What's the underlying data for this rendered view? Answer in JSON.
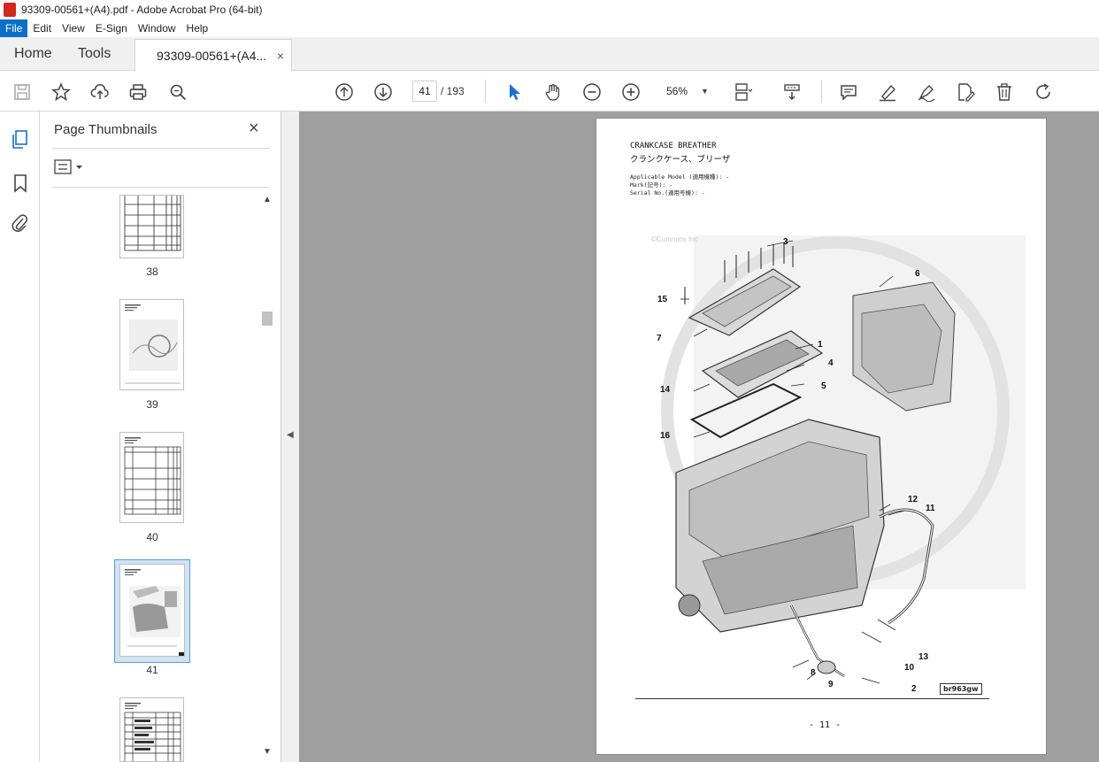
{
  "window": {
    "title": "93309-00561+(A4).pdf - Adobe Acrobat Pro (64-bit)"
  },
  "menu": [
    "File",
    "Edit",
    "View",
    "E-Sign",
    "Window",
    "Help"
  ],
  "tabs": {
    "home": "Home",
    "tools": "Tools",
    "document": "93309-00561+(A4...",
    "close": "×"
  },
  "toolbar": {
    "page_current": "41",
    "page_total": "/ 193",
    "zoom": "56%"
  },
  "thumbnails": {
    "title": "Page Thumbnails",
    "close": "×",
    "pages": [
      "38",
      "39",
      "40",
      "41",
      ""
    ]
  },
  "document": {
    "heading": "CRANKCASE BREATHER",
    "heading_jp": "クランクケース、ブリーザ",
    "applicable_model": "Applicable Model (適用機種): -",
    "mark": "Mark(記号): -",
    "serial": "Serial No.(適用号機): -",
    "watermark": "©Cummins Inc",
    "figure_code": "br963gw",
    "page_number": "- 11 -",
    "callouts": [
      "3",
      "6",
      "15",
      "7",
      "1",
      "4",
      "14",
      "5",
      "16",
      "12",
      "11",
      "13",
      "10",
      "8",
      "9",
      "2"
    ]
  },
  "colors": {
    "accent": "#0e6fc9",
    "doc_bg": "#9f9f9f",
    "selection": "#cfe3f5"
  }
}
